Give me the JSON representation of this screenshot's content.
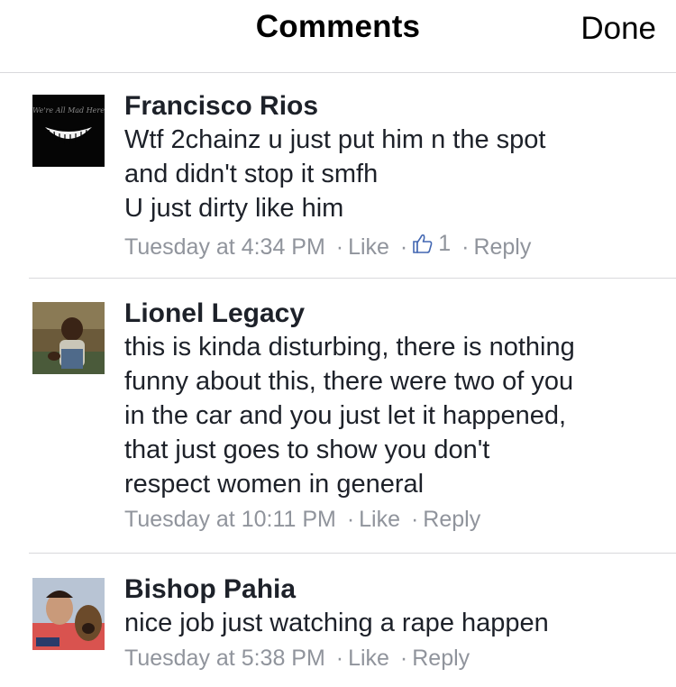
{
  "header": {
    "title": "Comments",
    "done_label": "Done"
  },
  "comments": [
    {
      "author": "Francisco Rios",
      "avatar_caption": "We're All Mad Here",
      "text": "Wtf 2chainz u just put him n the spot\nand didn't stop it smfh\nU just dirty like him",
      "time": "Tuesday at 4:34 PM",
      "like_label": "Like",
      "like_count": "1",
      "reply_label": "Reply"
    },
    {
      "author": "Lionel Legacy",
      "text": "this is kinda disturbing, there is nothing\nfunny about this, there were two of you\nin the car and you just let it happened,\nthat just goes to show you don't\nrespect women in general",
      "time": "Tuesday at 10:11 PM",
      "like_label": "Like",
      "reply_label": "Reply"
    },
    {
      "author": "Bishop Pahia",
      "text": "nice job just watching a rape happen",
      "time": "Tuesday at 5:38 PM",
      "like_label": "Like",
      "reply_label": "Reply"
    }
  ],
  "colors": {
    "text": "#1d2129",
    "meta": "#90949c",
    "like_blue": "#4267b2",
    "divider": "#d9d9dc"
  },
  "icons": {
    "like_count": "thumbs-up-icon"
  }
}
